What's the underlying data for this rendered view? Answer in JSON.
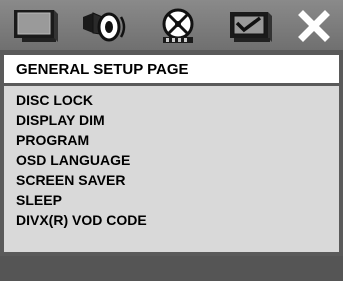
{
  "tabs": [
    {
      "icon": "general-setup-icon"
    },
    {
      "icon": "audio-setup-icon"
    },
    {
      "icon": "video-setup-icon"
    },
    {
      "icon": "preference-setup-icon"
    },
    {
      "icon": "close-icon"
    }
  ],
  "header": {
    "title": "GENERAL SETUP PAGE"
  },
  "menu": {
    "items": [
      {
        "label": "DISC LOCK"
      },
      {
        "label": "DISPLAY DIM"
      },
      {
        "label": "PROGRAM"
      },
      {
        "label": "OSD LANGUAGE"
      },
      {
        "label": "SCREEN SAVER"
      },
      {
        "label": "SLEEP"
      },
      {
        "label": "DIVX(R) VOD CODE"
      }
    ]
  },
  "colors": {
    "tabbar": "#7a7a7a",
    "header_bg": "#ffffff",
    "menu_bg": "#d9d9d9",
    "footer_bg": "#555555"
  }
}
